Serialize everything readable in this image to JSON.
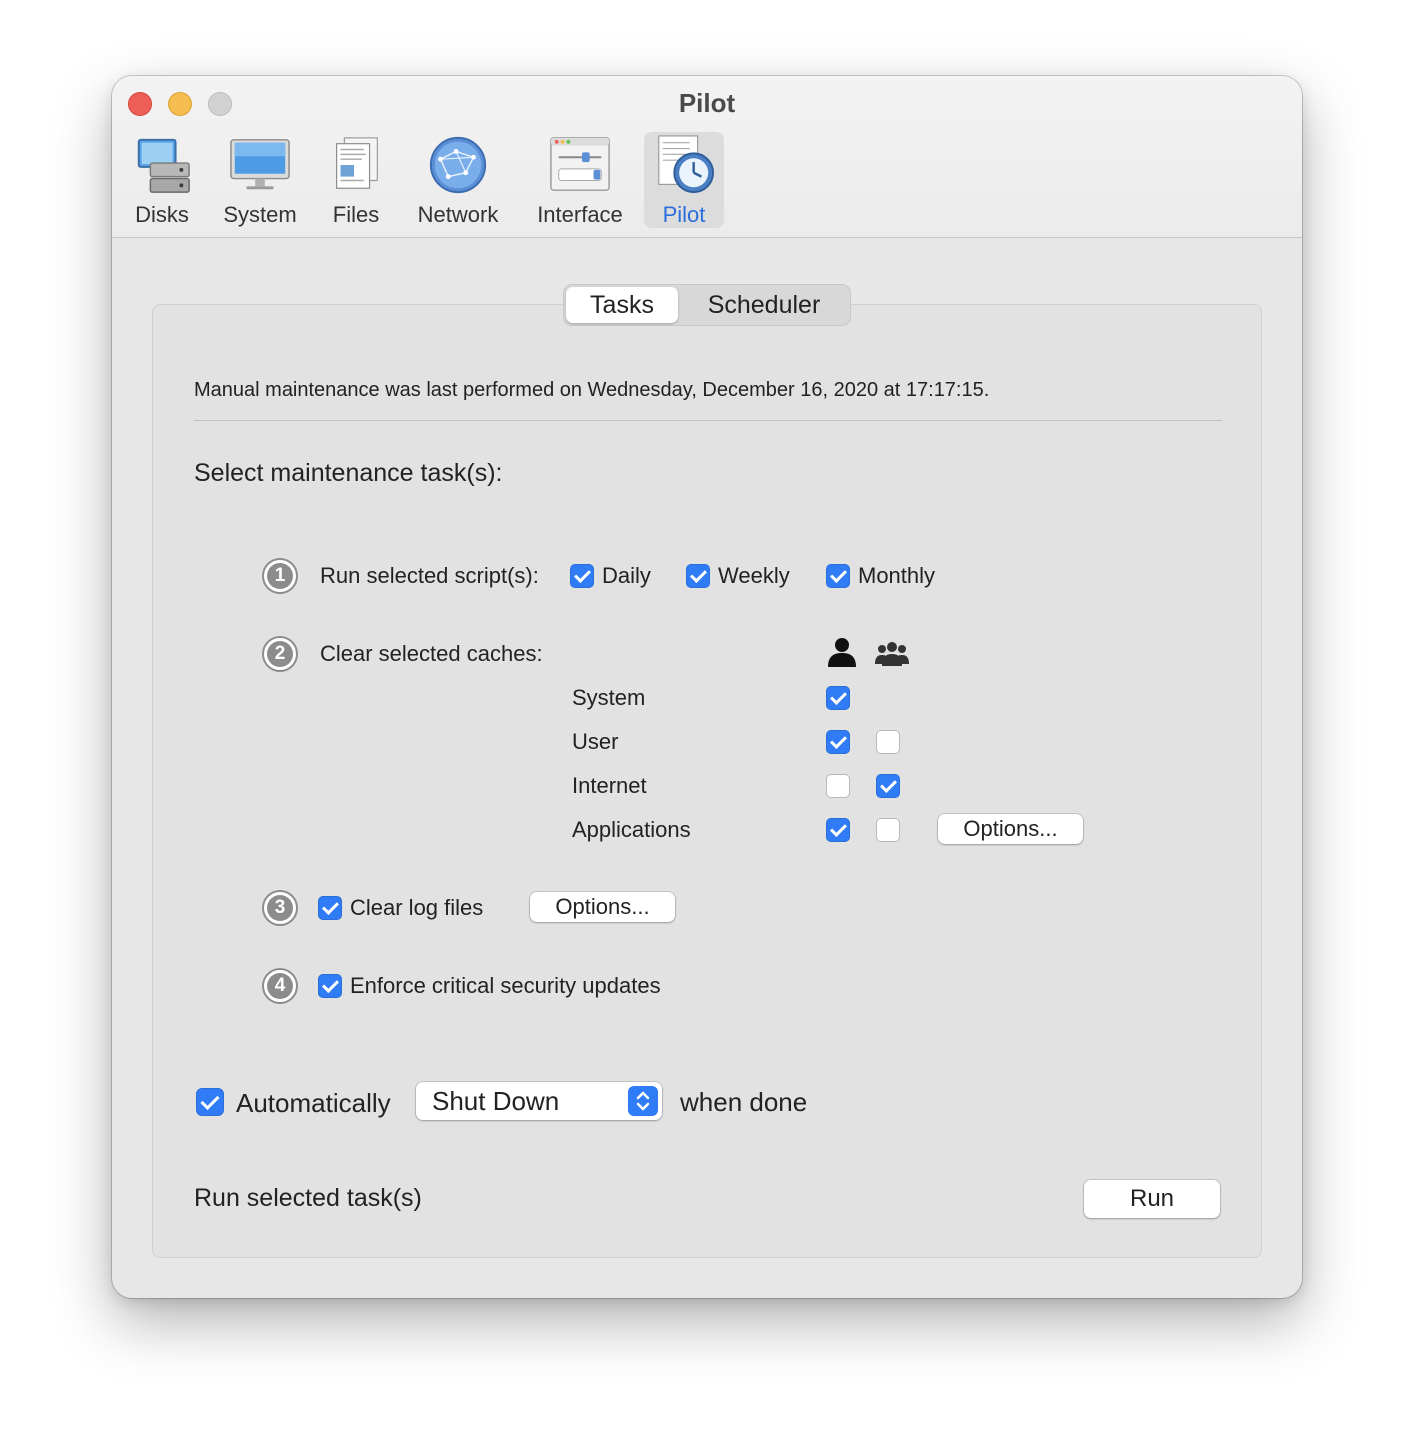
{
  "window": {
    "title": "Pilot"
  },
  "toolbar": {
    "items": [
      {
        "label": "Disks",
        "icon": "disks-icon"
      },
      {
        "label": "System",
        "icon": "monitor-icon"
      },
      {
        "label": "Files",
        "icon": "files-icon"
      },
      {
        "label": "Network",
        "icon": "network-globe-icon"
      },
      {
        "label": "Interface",
        "icon": "interface-window-icon"
      },
      {
        "label": "Pilot",
        "icon": "pilot-clock-icon",
        "selected": true
      }
    ]
  },
  "tabs": {
    "items": [
      "Tasks",
      "Scheduler"
    ],
    "selected": "Tasks"
  },
  "status_text": "Manual maintenance was last performed on Wednesday, December 16, 2020 at 17:17:15.",
  "section_heading": "Select maintenance task(s):",
  "task1": {
    "number": "1",
    "label": "Run selected script(s):",
    "options": [
      {
        "label": "Daily",
        "checked": true
      },
      {
        "label": "Weekly",
        "checked": true
      },
      {
        "label": "Monthly",
        "checked": true
      }
    ]
  },
  "task2": {
    "number": "2",
    "label": "Clear selected caches:",
    "column_icons": [
      "single-user-icon",
      "group-users-icon"
    ],
    "rows": [
      {
        "label": "System",
        "user": true,
        "all": null
      },
      {
        "label": "User",
        "user": true,
        "all": false
      },
      {
        "label": "Internet",
        "user": false,
        "all": true
      },
      {
        "label": "Applications",
        "user": true,
        "all": false
      }
    ],
    "options_label": "Options..."
  },
  "task3": {
    "number": "3",
    "label": "Clear log files",
    "checked": true,
    "options_label": "Options..."
  },
  "task4": {
    "number": "4",
    "label": "Enforce critical security updates",
    "checked": true
  },
  "auto": {
    "checked": true,
    "label": "Automatically",
    "action_value": "Shut Down",
    "suffix": "when done"
  },
  "run": {
    "label": "Run selected task(s)",
    "button_label": "Run"
  },
  "colors": {
    "accent": "#2f7cf6",
    "close": "#ed5f57",
    "minimize": "#f5bd4f",
    "zoom": "#d2d2d2"
  }
}
